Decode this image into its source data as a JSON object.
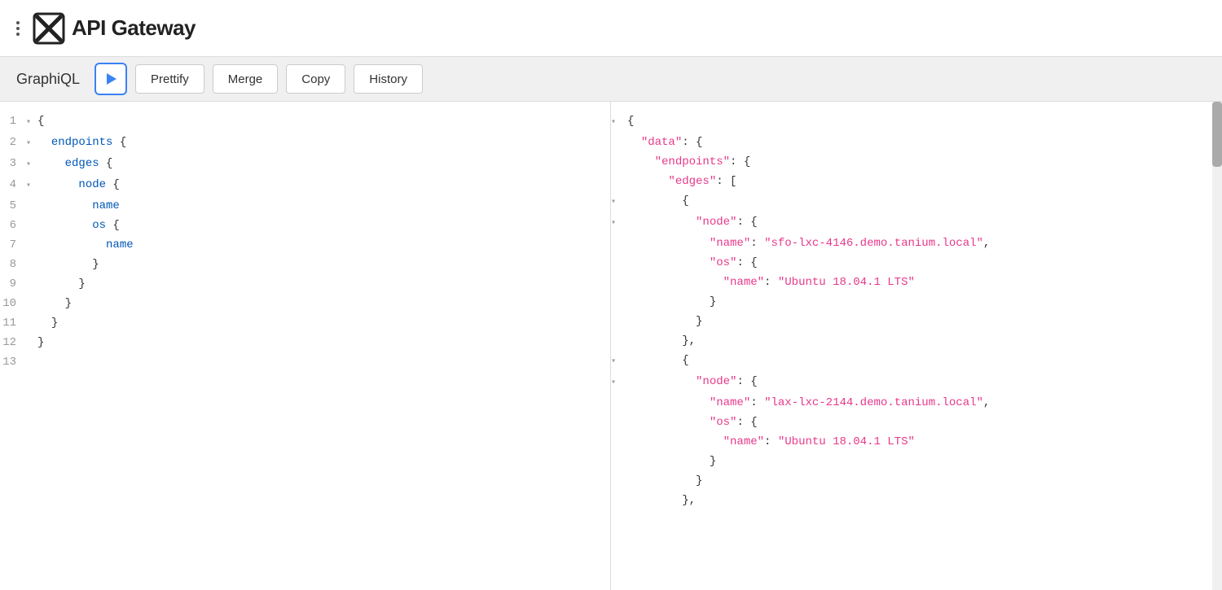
{
  "app": {
    "title": "API Gateway",
    "logo_alt": "Tanium"
  },
  "toolbar": {
    "label": "GraphiQL",
    "run_label": "Run",
    "prettify_label": "Prettify",
    "merge_label": "Merge",
    "copy_label": "Copy",
    "history_label": "History"
  },
  "query_lines": [
    {
      "num": "1",
      "fold": "▾",
      "indent": "",
      "content": "{"
    },
    {
      "num": "2",
      "fold": "▾",
      "indent": "  ",
      "content": "endpoints {"
    },
    {
      "num": "3",
      "fold": "▾",
      "indent": "    ",
      "content": "edges {"
    },
    {
      "num": "4",
      "fold": "▾",
      "indent": "      ",
      "content": "node {"
    },
    {
      "num": "5",
      "fold": " ",
      "indent": "        ",
      "content": "name"
    },
    {
      "num": "6",
      "fold": " ",
      "indent": "        ",
      "content": "os {"
    },
    {
      "num": "7",
      "fold": " ",
      "indent": "          ",
      "content": "name"
    },
    {
      "num": "8",
      "fold": " ",
      "indent": "        ",
      "content": "}"
    },
    {
      "num": "9",
      "fold": " ",
      "indent": "      ",
      "content": "}"
    },
    {
      "num": "10",
      "fold": " ",
      "indent": "    ",
      "content": "}"
    },
    {
      "num": "11",
      "fold": " ",
      "indent": "  ",
      "content": "}"
    },
    {
      "num": "12",
      "fold": " ",
      "indent": "",
      "content": "}"
    },
    {
      "num": "13",
      "fold": " ",
      "indent": "",
      "content": ""
    }
  ],
  "result_lines": [
    {
      "fold": "▾",
      "indent": "",
      "parts": [
        {
          "t": "brace",
          "v": "{"
        }
      ]
    },
    {
      "fold": " ",
      "indent": "  ",
      "parts": [
        {
          "t": "key",
          "v": "\"data\""
        },
        {
          "t": "brace",
          "v": ": {"
        }
      ]
    },
    {
      "fold": " ",
      "indent": "    ",
      "parts": [
        {
          "t": "key",
          "v": "\"endpoints\""
        },
        {
          "t": "brace",
          "v": ": {"
        }
      ]
    },
    {
      "fold": " ",
      "indent": "      ",
      "parts": [
        {
          "t": "key",
          "v": "\"edges\""
        },
        {
          "t": "brace",
          "v": ": ["
        }
      ]
    },
    {
      "fold": "▾",
      "indent": "        ",
      "parts": [
        {
          "t": "brace",
          "v": "{"
        }
      ]
    },
    {
      "fold": "▾",
      "indent": "          ",
      "parts": [
        {
          "t": "key",
          "v": "\"node\""
        },
        {
          "t": "brace",
          "v": ": {"
        }
      ]
    },
    {
      "fold": " ",
      "indent": "            ",
      "parts": [
        {
          "t": "key",
          "v": "\"name\""
        },
        {
          "t": "punct",
          "v": ": "
        },
        {
          "t": "str",
          "v": "\"sfo-lxc-4146.demo.tanium.local\""
        },
        {
          "t": "punct",
          "v": ","
        }
      ]
    },
    {
      "fold": " ",
      "indent": "            ",
      "parts": [
        {
          "t": "key",
          "v": "\"os\""
        },
        {
          "t": "brace",
          "v": ": {"
        }
      ]
    },
    {
      "fold": " ",
      "indent": "              ",
      "parts": [
        {
          "t": "key",
          "v": "\"name\""
        },
        {
          "t": "punct",
          "v": ": "
        },
        {
          "t": "str",
          "v": "\"Ubuntu 18.04.1 LTS\""
        }
      ]
    },
    {
      "fold": " ",
      "indent": "            ",
      "parts": [
        {
          "t": "brace",
          "v": "}"
        }
      ]
    },
    {
      "fold": " ",
      "indent": "          ",
      "parts": [
        {
          "t": "brace",
          "v": "}"
        }
      ]
    },
    {
      "fold": " ",
      "indent": "        ",
      "parts": [
        {
          "t": "brace",
          "v": "},"
        }
      ]
    },
    {
      "fold": "▾",
      "indent": "        ",
      "parts": [
        {
          "t": "brace",
          "v": "{"
        }
      ]
    },
    {
      "fold": "▾",
      "indent": "          ",
      "parts": [
        {
          "t": "key",
          "v": "\"node\""
        },
        {
          "t": "brace",
          "v": ": {"
        }
      ]
    },
    {
      "fold": " ",
      "indent": "            ",
      "parts": [
        {
          "t": "key",
          "v": "\"name\""
        },
        {
          "t": "punct",
          "v": ": "
        },
        {
          "t": "str",
          "v": "\"lax-lxc-2144.demo.tanium.local\""
        },
        {
          "t": "punct",
          "v": ","
        }
      ]
    },
    {
      "fold": " ",
      "indent": "            ",
      "parts": [
        {
          "t": "key",
          "v": "\"os\""
        },
        {
          "t": "brace",
          "v": ": {"
        }
      ]
    },
    {
      "fold": " ",
      "indent": "              ",
      "parts": [
        {
          "t": "key",
          "v": "\"name\""
        },
        {
          "t": "punct",
          "v": ": "
        },
        {
          "t": "str",
          "v": "\"Ubuntu 18.04.1 LTS\""
        }
      ]
    },
    {
      "fold": " ",
      "indent": "            ",
      "parts": [
        {
          "t": "brace",
          "v": "}"
        }
      ]
    },
    {
      "fold": " ",
      "indent": "          ",
      "parts": [
        {
          "t": "brace",
          "v": "}"
        }
      ]
    },
    {
      "fold": " ",
      "indent": "        ",
      "parts": [
        {
          "t": "brace",
          "v": "},"
        }
      ]
    }
  ],
  "colors": {
    "keyword_blue": "#0057b8",
    "string_pink": "#e8388a",
    "brace_dark": "#333333",
    "accent_blue": "#3b82f6"
  }
}
